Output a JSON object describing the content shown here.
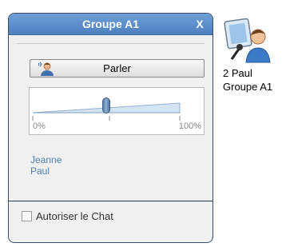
{
  "panel": {
    "title": "Groupe A1",
    "close_label": "X",
    "talk_button_label": "Parler",
    "volume": {
      "level_percent": 50,
      "min_label": "0%",
      "max_label": "100%"
    },
    "members": [
      "Jeanne",
      "Paul"
    ],
    "allow_chat": {
      "label": "Autoriser le Chat",
      "checked": false
    }
  },
  "user_tile": {
    "line1": "2 Paul",
    "line2": "Groupe A1",
    "icon": "user-monitor-icon"
  },
  "colors": {
    "title_bar": "#5b8dcb",
    "member_text": "#4d7fb3",
    "panel_bg": "#f0f0f0"
  }
}
